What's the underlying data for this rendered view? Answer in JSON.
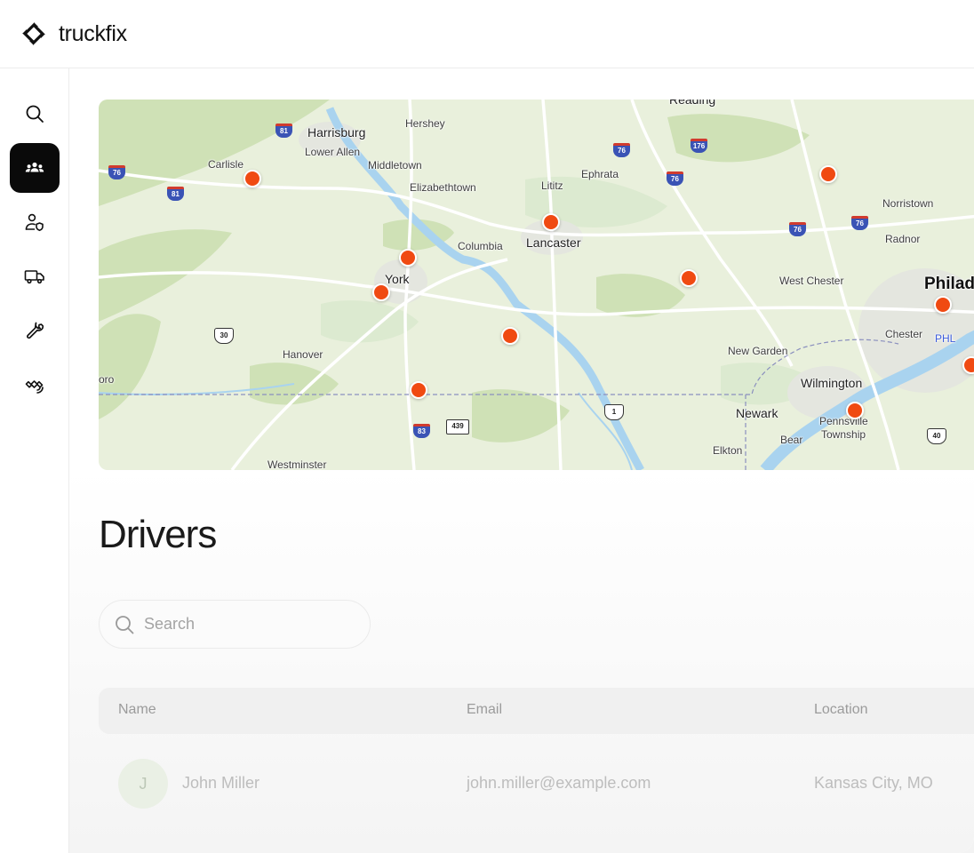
{
  "app": {
    "brand": "truckfix"
  },
  "sidebar": {
    "items": [
      {
        "name": "search",
        "icon": "search-icon",
        "active": false
      },
      {
        "name": "drivers",
        "icon": "group-icon",
        "active": true
      },
      {
        "name": "users",
        "icon": "user-shield-icon",
        "active": false
      },
      {
        "name": "trucks",
        "icon": "truck-icon",
        "active": false
      },
      {
        "name": "repairs",
        "icon": "wrench-icon",
        "active": false
      },
      {
        "name": "telematics",
        "icon": "satellite-icon",
        "active": false
      }
    ]
  },
  "map": {
    "labels": {
      "reading": "Reading",
      "harrisburg": "Harrisburg",
      "hershey": "Hershey",
      "lower_allen": "Lower Allen",
      "carlisle": "Carlisle",
      "middletown": "Middletown",
      "elizabethtown": "Elizabethtown",
      "lititz": "Lititz",
      "ephrata": "Ephrata",
      "norristown": "Norristown",
      "radnor": "Radnor",
      "columbia": "Columbia",
      "lancaster": "Lancaster",
      "york": "York",
      "west_chester": "West Chester",
      "philadelphia": "Philad",
      "chester": "Chester",
      "phl": "PHL",
      "hanover": "Hanover",
      "new_garden": "New Garden",
      "oro": "oro",
      "wilmington": "Wilmington",
      "newark": "Newark",
      "pennsville": "Pennsville",
      "township": "Township",
      "bear": "Bear",
      "elkton": "Elkton",
      "westminster": "Westminster"
    },
    "shields": {
      "i81_a": "81",
      "i81_b": "81",
      "i76_a": "76",
      "i76_b": "76",
      "i76_c": "76",
      "i76_d": "76",
      "i76_e": "76",
      "i176": "176",
      "i83": "83",
      "us30": "30",
      "us1": "1",
      "us40": "40",
      "sr439": "439"
    },
    "pin_color": "#f04a12",
    "pin_count": 11
  },
  "page": {
    "title": "Drivers"
  },
  "search": {
    "placeholder": "Search"
  },
  "table": {
    "columns": [
      "Name",
      "Email",
      "Location"
    ],
    "rows": [
      {
        "initial": "J",
        "name": "John Miller",
        "email": "john.miller@example.com",
        "location": "Kansas City, MO"
      }
    ]
  }
}
